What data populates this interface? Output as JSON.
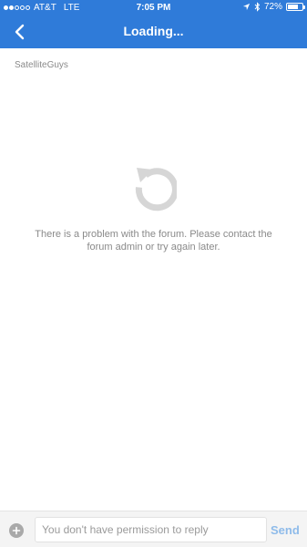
{
  "status_bar": {
    "carrier": "AT&T",
    "network": "LTE",
    "time": "7:05 PM",
    "battery_label": "72%",
    "battery_level": 0.72,
    "signal_bars": 2,
    "icons": [
      "location-arrow-icon",
      "bluetooth-icon",
      "battery-icon"
    ]
  },
  "header": {
    "title": "Loading...",
    "back_icon": "chevron-left-icon",
    "color": "#2f7bd9"
  },
  "forum": {
    "name": "SatelliteGuys"
  },
  "error": {
    "icon": "reload-icon",
    "message": "There is a problem with the forum. Please contact the forum admin or try again later."
  },
  "reply_bar": {
    "attach_icon": "plus-circle-icon",
    "placeholder": "You don't have permission to reply",
    "send_label": "Send"
  }
}
